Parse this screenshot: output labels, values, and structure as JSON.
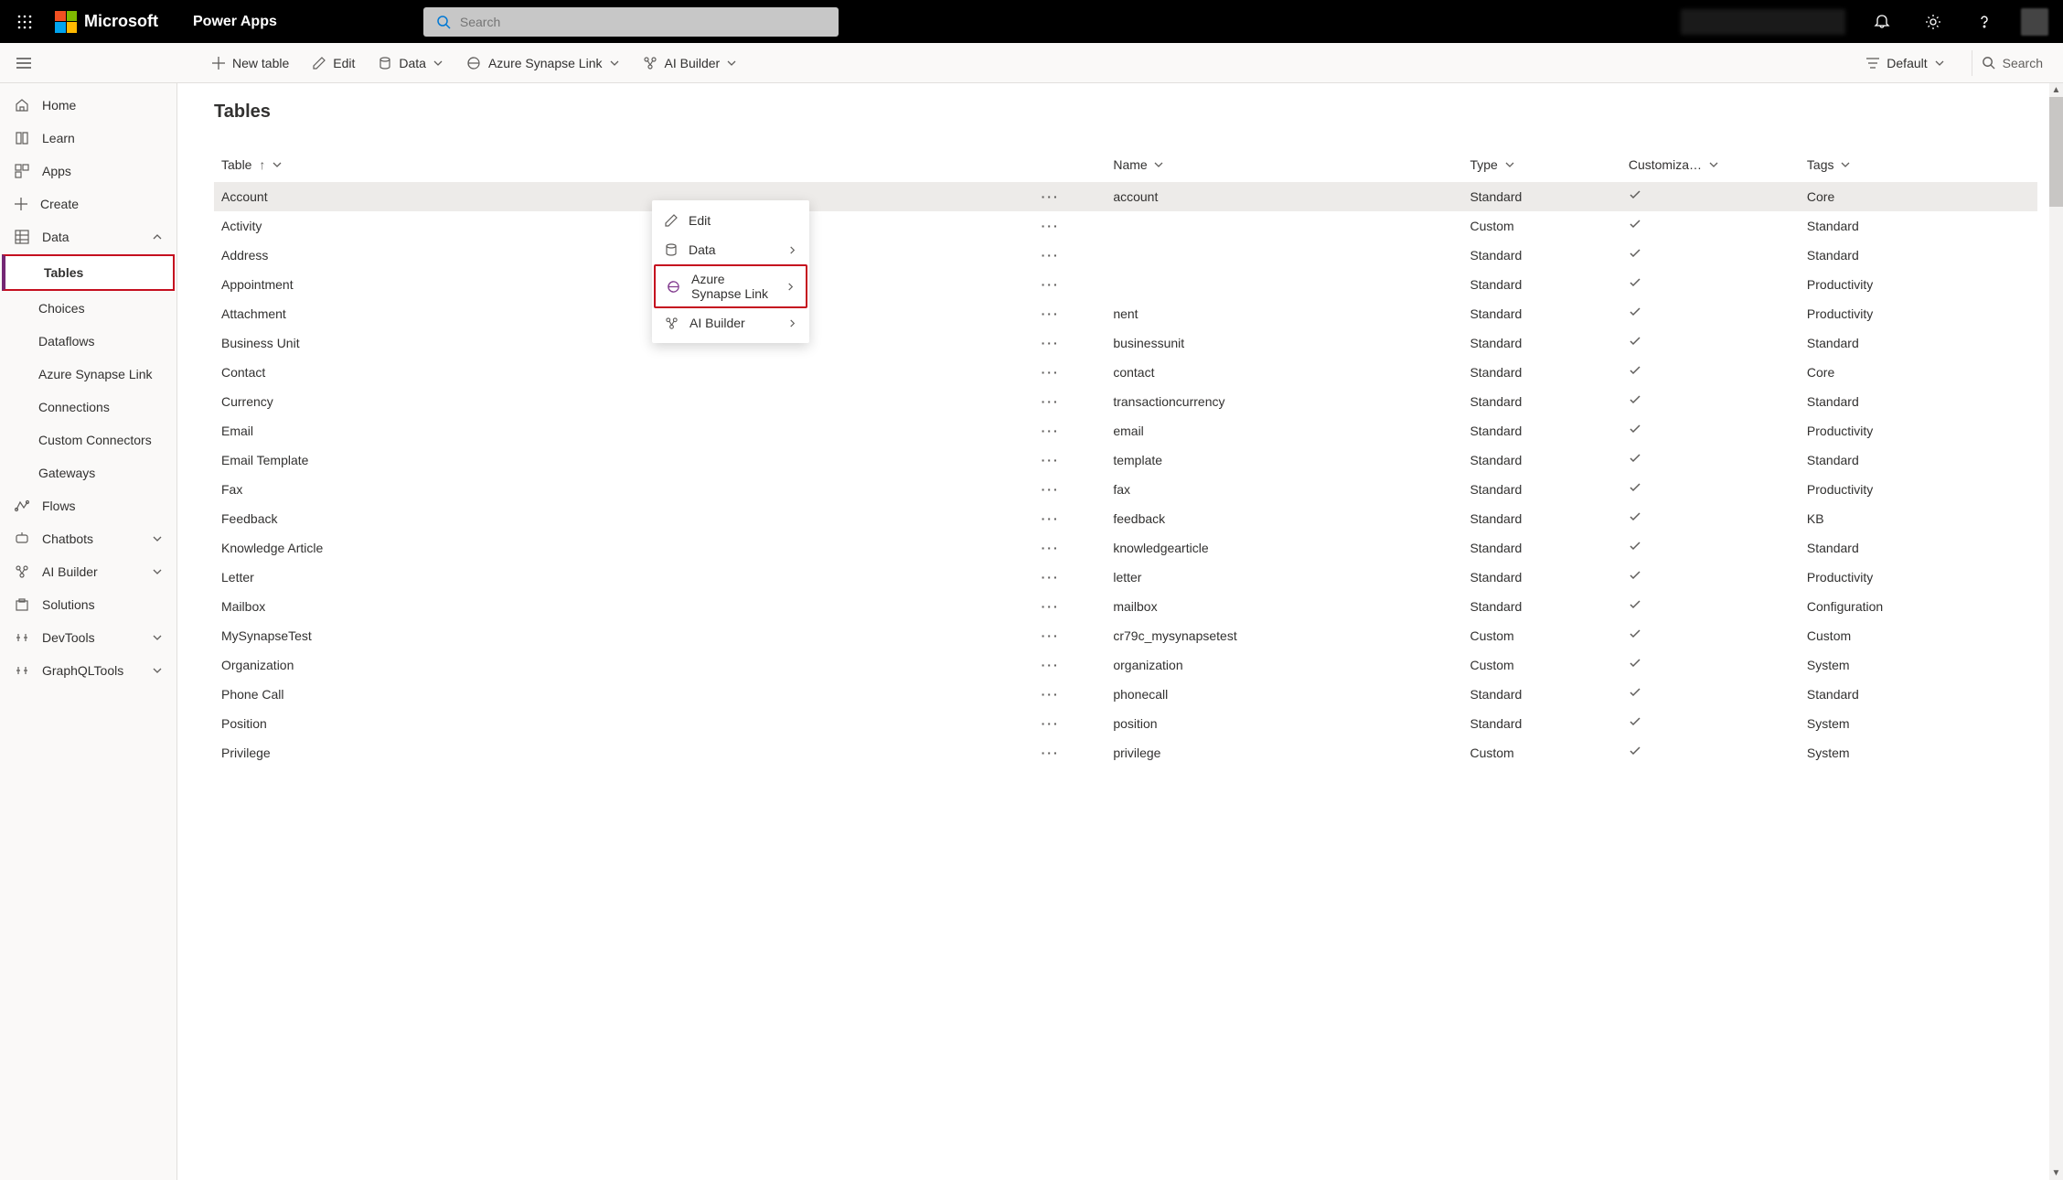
{
  "header": {
    "brand": "Microsoft",
    "app_name": "Power Apps",
    "search_placeholder": "Search"
  },
  "toolbar": {
    "new_table": "New table",
    "edit": "Edit",
    "data": "Data",
    "azure": "Azure Synapse Link",
    "ai": "AI Builder",
    "view": "Default",
    "search": "Search"
  },
  "sidebar": {
    "home": "Home",
    "learn": "Learn",
    "apps": "Apps",
    "create": "Create",
    "data": "Data",
    "data_children": {
      "tables": "Tables",
      "choices": "Choices",
      "dataflows": "Dataflows",
      "synapse": "Azure Synapse Link",
      "connections": "Connections",
      "custom": "Custom Connectors",
      "gateways": "Gateways"
    },
    "flows": "Flows",
    "chatbots": "Chatbots",
    "ai": "AI Builder",
    "solutions": "Solutions",
    "devtools": "DevTools",
    "graphql": "GraphQLTools"
  },
  "page_title": "Tables",
  "columns": {
    "table": "Table",
    "name": "Name",
    "type": "Type",
    "custom": "Customiza…",
    "tags": "Tags"
  },
  "context_menu": {
    "edit": "Edit",
    "data": "Data",
    "azure": "Azure Synapse Link",
    "ai": "AI Builder"
  },
  "rows": [
    {
      "table": "Account",
      "name": "account",
      "type": "Standard",
      "cust": true,
      "tags": "Core"
    },
    {
      "table": "Activity",
      "name": "",
      "type": "Custom",
      "cust": true,
      "tags": "Standard"
    },
    {
      "table": "Address",
      "name": "",
      "type": "Standard",
      "cust": true,
      "tags": "Standard"
    },
    {
      "table": "Appointment",
      "name": "",
      "type": "Standard",
      "cust": true,
      "tags": "Productivity"
    },
    {
      "table": "Attachment",
      "name": "nent",
      "type": "Standard",
      "cust": true,
      "tags": "Productivity"
    },
    {
      "table": "Business Unit",
      "name": "businessunit",
      "type": "Standard",
      "cust": true,
      "tags": "Standard"
    },
    {
      "table": "Contact",
      "name": "contact",
      "type": "Standard",
      "cust": true,
      "tags": "Core"
    },
    {
      "table": "Currency",
      "name": "transactioncurrency",
      "type": "Standard",
      "cust": true,
      "tags": "Standard"
    },
    {
      "table": "Email",
      "name": "email",
      "type": "Standard",
      "cust": true,
      "tags": "Productivity"
    },
    {
      "table": "Email Template",
      "name": "template",
      "type": "Standard",
      "cust": true,
      "tags": "Standard"
    },
    {
      "table": "Fax",
      "name": "fax",
      "type": "Standard",
      "cust": true,
      "tags": "Productivity"
    },
    {
      "table": "Feedback",
      "name": "feedback",
      "type": "Standard",
      "cust": true,
      "tags": "KB"
    },
    {
      "table": "Knowledge Article",
      "name": "knowledgearticle",
      "type": "Standard",
      "cust": true,
      "tags": "Standard"
    },
    {
      "table": "Letter",
      "name": "letter",
      "type": "Standard",
      "cust": true,
      "tags": "Productivity"
    },
    {
      "table": "Mailbox",
      "name": "mailbox",
      "type": "Standard",
      "cust": true,
      "tags": "Configuration"
    },
    {
      "table": "MySynapseTest",
      "name": "cr79c_mysynapsetest",
      "type": "Custom",
      "cust": true,
      "tags": "Custom"
    },
    {
      "table": "Organization",
      "name": "organization",
      "type": "Custom",
      "cust": true,
      "tags": "System"
    },
    {
      "table": "Phone Call",
      "name": "phonecall",
      "type": "Standard",
      "cust": true,
      "tags": "Standard"
    },
    {
      "table": "Position",
      "name": "position",
      "type": "Standard",
      "cust": true,
      "tags": "System"
    },
    {
      "table": "Privilege",
      "name": "privilege",
      "type": "Custom",
      "cust": true,
      "tags": "System"
    }
  ]
}
